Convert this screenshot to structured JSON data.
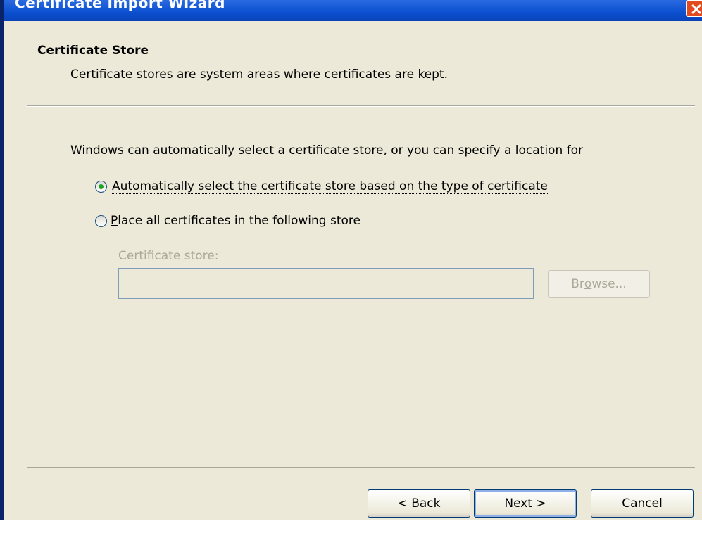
{
  "window": {
    "title": "Certificate Import Wizard"
  },
  "header": {
    "title": "Certificate Store",
    "subtitle": "Certificate stores are system areas where certificates are kept."
  },
  "body": {
    "intro": "Windows can automatically select a certificate store, or you can specify a location for",
    "options": [
      {
        "mnemonic": "A",
        "rest": "utomatically select the certificate store based on the type of certificate",
        "checked": true
      },
      {
        "mnemonic": "P",
        "rest": "lace all certificates in the following store",
        "checked": false
      }
    ],
    "store_label": "Certificate store:",
    "store_value": "",
    "browse": {
      "pre": "Br",
      "mnemonic": "o",
      "post": "wse..."
    }
  },
  "footer": {
    "back": {
      "pre": "< ",
      "mnemonic": "B",
      "post": "ack"
    },
    "next": {
      "pre": "",
      "mnemonic": "N",
      "post": "ext >"
    },
    "cancel": "Cancel"
  },
  "colors": {
    "dialog_bg": "#ece9d8",
    "titlebar": "#0b4fd0",
    "close": "#e24a1f",
    "disabled_text": "#aca899",
    "radio_dot": "#21a121"
  },
  "icons": [
    "close-icon"
  ]
}
